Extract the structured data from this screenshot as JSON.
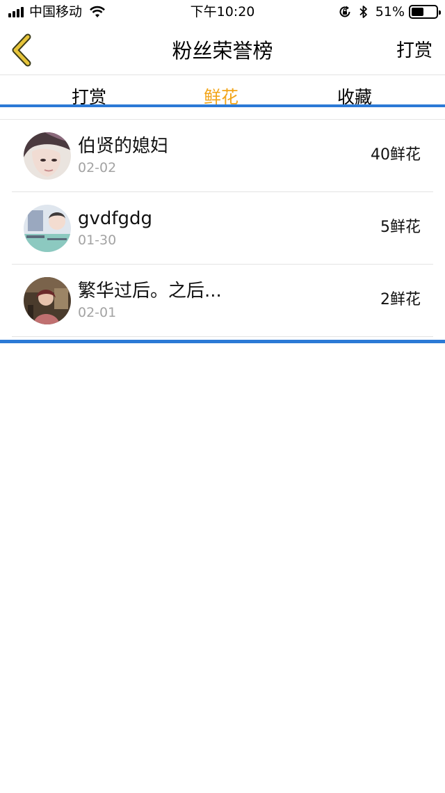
{
  "status_bar": {
    "carrier": "中国移动",
    "time": "下午10:20",
    "battery_percent": "51%",
    "battery_level": 0.51
  },
  "nav": {
    "title": "粉丝荣誉榜",
    "right_action": "打赏",
    "back_icon": "chevron-left-icon"
  },
  "tabs": [
    {
      "label": "打赏",
      "active": false
    },
    {
      "label": "鲜花",
      "active": true
    },
    {
      "label": "收藏",
      "active": false
    }
  ],
  "colors": {
    "accent_tab": "#f2a51a",
    "rule_blue": "#2b7ad6",
    "back_arrow": "#e6c43a"
  },
  "fans": [
    {
      "name": "伯贤的媳妇",
      "date": "02-02",
      "count": "40鲜花"
    },
    {
      "name": "gvdfgdg",
      "date": "01-30",
      "count": "5鲜花"
    },
    {
      "name": "繁华过后。之后...",
      "date": "02-01",
      "count": "2鲜花"
    }
  ]
}
